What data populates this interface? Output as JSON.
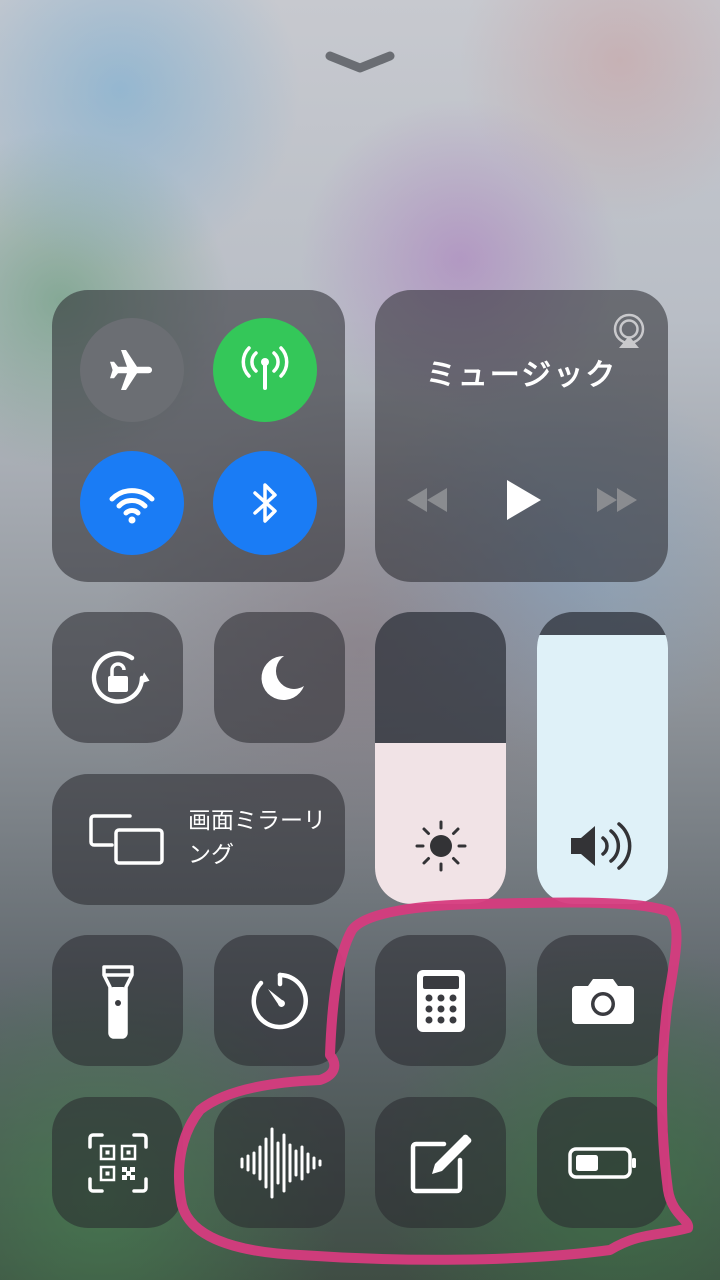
{
  "control_center": {
    "dismiss": {
      "icon": "chevron-down-icon"
    },
    "connectivity": {
      "airplane": {
        "icon": "airplane-icon",
        "state": "off",
        "color": "#6b6e73"
      },
      "cellular": {
        "icon": "cellular-antenna-icon",
        "state": "on",
        "color": "#34c759"
      },
      "wifi": {
        "icon": "wifi-icon",
        "state": "on",
        "color": "#1a7cf5"
      },
      "bluetooth": {
        "icon": "bluetooth-icon",
        "state": "on",
        "color": "#1a7cf5"
      }
    },
    "music": {
      "title": "ミュージック",
      "airplay_icon": "airplay-icon",
      "controls": [
        "rewind-icon",
        "play-icon",
        "fast-forward-icon"
      ]
    },
    "toggles": {
      "orientation_lock": {
        "icon": "orientation-lock-icon"
      },
      "do_not_disturb": {
        "icon": "moon-icon"
      }
    },
    "screen_mirroring": {
      "label": "画面ミラーリング",
      "icon": "screen-mirroring-icon"
    },
    "sliders": {
      "brightness": {
        "icon": "sun-icon",
        "level": 0.55,
        "fill_color": "#f1e3e6"
      },
      "volume": {
        "icon": "speaker-icon",
        "level": 0.92,
        "fill_color": "#dff1f8"
      }
    },
    "shortcuts_row1": [
      {
        "name": "flashlight",
        "icon": "flashlight-icon"
      },
      {
        "name": "timer",
        "icon": "timer-icon"
      },
      {
        "name": "calculator",
        "icon": "calculator-icon"
      },
      {
        "name": "camera",
        "icon": "camera-icon"
      }
    ],
    "shortcuts_row2": [
      {
        "name": "qr-scanner",
        "icon": "qr-code-icon"
      },
      {
        "name": "voice-memos",
        "icon": "waveform-icon"
      },
      {
        "name": "notes",
        "icon": "note-edit-icon"
      },
      {
        "name": "low-power-mode",
        "icon": "battery-icon"
      }
    ],
    "annotation_color": "#d63b7e"
  }
}
